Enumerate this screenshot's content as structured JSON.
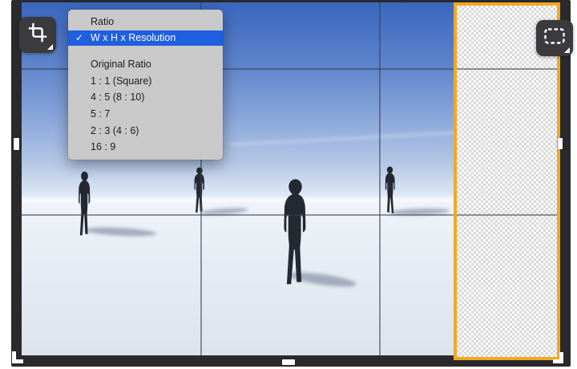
{
  "toolbar": {
    "crop_tool": {
      "icon": "crop-icon",
      "tooltip": "Crop"
    },
    "marquee_tool": {
      "icon": "marquee-icon",
      "tooltip": "Selection"
    }
  },
  "menu": {
    "header": "Ratio",
    "checkmark": "✓",
    "selected_item": "W x H x Resolution",
    "items": [
      "Original Ratio",
      "1 : 1 (Square)",
      "4 : 5 (8 : 10)",
      "5 : 7",
      "2 : 3 (4 : 6)",
      "16 : 9"
    ]
  },
  "crop": {
    "grid": "3x3",
    "extension_region": "transparent checkerboard strip on right"
  },
  "scene": {
    "figures": 4
  },
  "colors": {
    "accent_orange": "#F5A623",
    "highlight_blue": "#1E60E0",
    "frame_dark": "#2A2A2C",
    "button_dark": "#3B3B3D",
    "menu_bg": "#C9C9C9"
  }
}
